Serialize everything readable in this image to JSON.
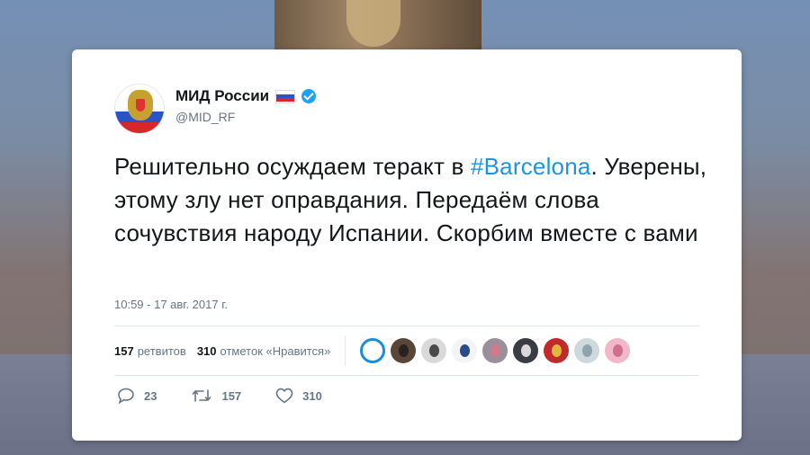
{
  "account": {
    "name": "МИД России",
    "handle": "@MID_RF",
    "flag_colors": [
      "#ffffff",
      "#2a54c5",
      "#d62828"
    ],
    "verified_icon": "verified-badge-icon",
    "verified_color": "#1da1f2"
  },
  "tweet": {
    "text_before": "Решительно осуждаем теракт в ",
    "hashtag": "#Barcelona",
    "text_after": ". Уверены, этому злу нет оправдания. Передаём слова сочувствия народу Испании. Скорбим вместе с вами",
    "hashtag_color": "#1b95e0",
    "timestamp": "10:59 - 17 авг. 2017 г."
  },
  "stats": {
    "retweets_count": "157",
    "retweets_label": "ретвитов",
    "likes_count": "310",
    "likes_label": "отметок «Нравится»",
    "likers": [
      {
        "name": "liker-avatar-1",
        "color": "#ffffff",
        "accent": "#1a8fd8"
      },
      {
        "name": "liker-avatar-2",
        "color": "#5a4638",
        "accent": "#2a2220"
      },
      {
        "name": "liker-avatar-3",
        "color": "#d9d9d9",
        "accent": "#4a4a4a"
      },
      {
        "name": "liker-avatar-4",
        "color": "#f2f4f8",
        "accent": "#2b4a8a"
      },
      {
        "name": "liker-avatar-5",
        "color": "#9a8f9b",
        "accent": "#d07a8c"
      },
      {
        "name": "liker-avatar-6",
        "color": "#3a3c44",
        "accent": "#d8d8d8"
      },
      {
        "name": "liker-avatar-7",
        "color": "#c02a2a",
        "accent": "#e0b640"
      },
      {
        "name": "liker-avatar-8",
        "color": "#cfd8dc",
        "accent": "#90a4ae"
      },
      {
        "name": "liker-avatar-9",
        "color": "#f0b8c8",
        "accent": "#d07090"
      }
    ]
  },
  "actions": {
    "reply_icon": "reply-icon",
    "reply_count": "23",
    "retweet_icon": "retweet-icon",
    "retweet_count": "157",
    "like_icon": "heart-icon",
    "like_count": "310"
  }
}
